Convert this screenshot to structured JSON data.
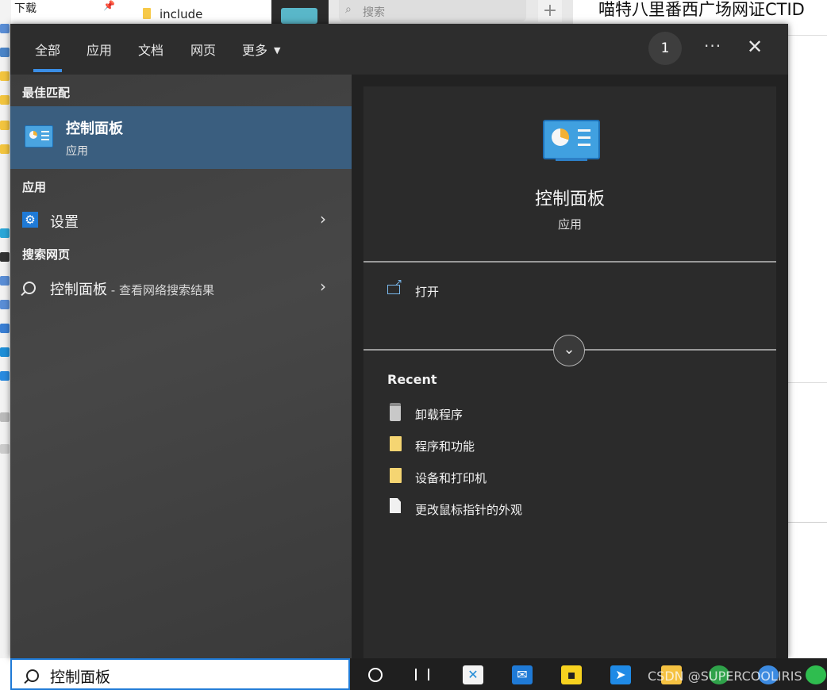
{
  "background": {
    "explorer_item": "下载",
    "include_folder": "include",
    "browser_search_placeholder": "搜索",
    "browser_new_tab": "+",
    "doc_title": "喵特八里番西广场网证CTID"
  },
  "start_menu": {
    "tabs": [
      {
        "label": "全部",
        "active": true
      },
      {
        "label": "应用",
        "active": false
      },
      {
        "label": "文档",
        "active": false
      },
      {
        "label": "网页",
        "active": false
      },
      {
        "label": "更多",
        "active": false
      }
    ],
    "badge_count": "1",
    "more_options": "···",
    "close": "✕",
    "best_match": {
      "heading": "最佳匹配",
      "title": "控制面板",
      "subtitle": "应用"
    },
    "apps": {
      "heading": "应用",
      "items": [
        {
          "label": "设置"
        }
      ]
    },
    "web": {
      "heading": "搜索网页",
      "items": [
        {
          "label": "控制面板",
          "sub": " - 查看网络搜索结果"
        }
      ]
    },
    "detail": {
      "title": "控制面板",
      "subtitle": "应用",
      "open_label": "打开",
      "expand": "⌄",
      "recent_heading": "Recent",
      "recent": [
        {
          "label": "卸载程序",
          "icon": "installer-icon"
        },
        {
          "label": "程序和功能",
          "icon": "folder-icon"
        },
        {
          "label": "设备和打印机",
          "icon": "folder-icon"
        },
        {
          "label": "更改鼠标指针的外观",
          "icon": "document-icon"
        }
      ]
    }
  },
  "search_box": {
    "value": "控制面板"
  },
  "taskbar": {
    "apps": [
      "cortana",
      "task-view",
      "xmind",
      "mail",
      "sticky-notes",
      "feishu"
    ]
  },
  "watermark": "CSDN @SUPERCOOLIRIS"
}
